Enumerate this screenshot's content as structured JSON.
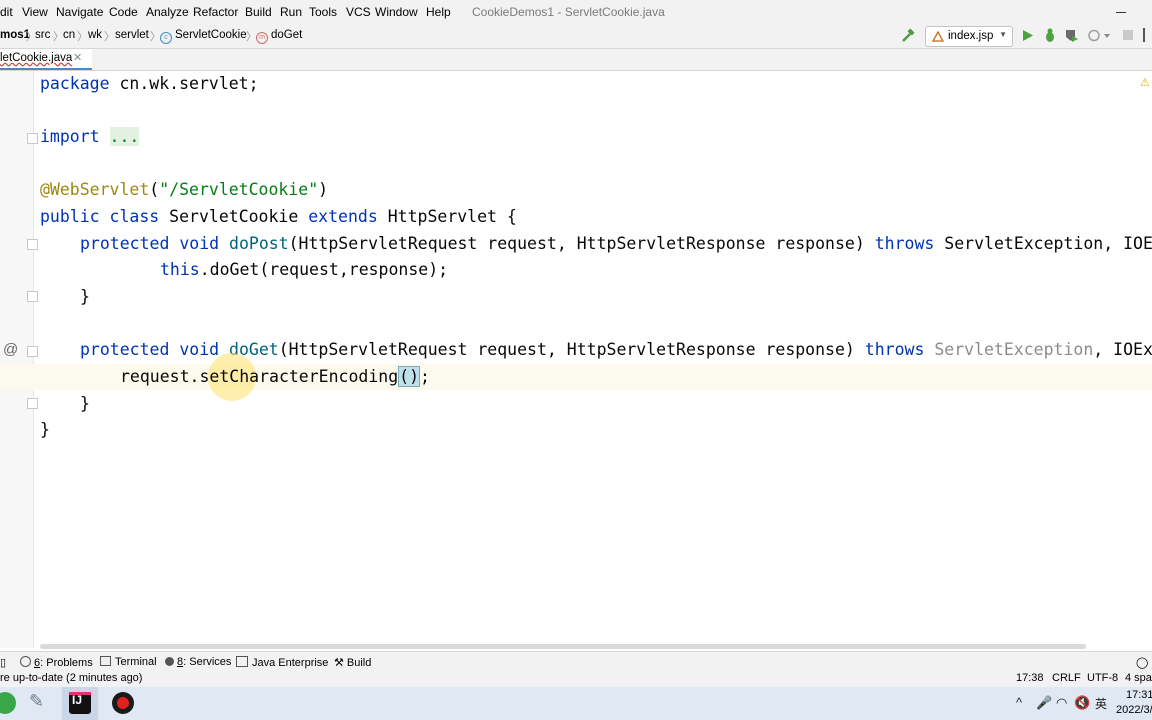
{
  "menubar": {
    "items": [
      "dit",
      "View",
      "Navigate",
      "Code",
      "Analyze",
      "Refactor",
      "Build",
      "Run",
      "Tools",
      "VCS",
      "Window",
      "Help"
    ],
    "window_title": "CookieDemos1 - ServletCookie.java"
  },
  "navbar": {
    "crumbs": [
      "mos1",
      "src",
      "cn",
      "wk",
      "servlet",
      "ServletCookie",
      "doGet"
    ],
    "run_config": "index.jsp"
  },
  "tabs": {
    "active": "letCookie.java"
  },
  "editor": {
    "lines": {
      "l1_kw": "package",
      "l1_rest": " cn.wk.servlet;",
      "l3_kw": "import",
      "l3_dots": "...",
      "l5_ann": "@WebServlet",
      "l5_open": "(",
      "l5_str": "\"/ServletCookie\"",
      "l5_close": ")",
      "l6_kw": "public class",
      "l6_name": " ServletCookie ",
      "l6_kw2": "extends",
      "l6_rest": " HttpServlet {",
      "l7_kw": "protected void",
      "l7_fn": "doPost",
      "l7_params": "(HttpServletRequest request, HttpServletResponse response) ",
      "l7_throws": "throws",
      "l7_rest": " ServletException, IOE",
      "l8_kw": "this",
      "l8_rest": ".doGet(request,response);",
      "l9": "}",
      "l11_kw": "protected void",
      "l11_fn": "doGet",
      "l11_params": "(HttpServletRequest request, HttpServletResponse response) ",
      "l11_throws": "throws",
      "l11_gray": " ServletException",
      "l11_rest": ", IOEx",
      "l12_pre": "request.setCharacterEncoding",
      "l12_paren": "()",
      "l12_end": ";",
      "l13": "}",
      "l14": "}"
    },
    "gutter_marker": "@"
  },
  "tool_windows": {
    "problems_num": "6",
    "problems": ": Problems",
    "terminal": "Terminal",
    "services_num": "8",
    "services": ": Services",
    "java_enterprise": "Java Enterprise",
    "build": "Build"
  },
  "statusbar": {
    "message": "re up-to-date (2 minutes ago)",
    "position": "17:38",
    "line_sep": "CRLF",
    "encoding": "UTF-8",
    "indent": "4 spac"
  },
  "taskbar": {
    "time": "17:31",
    "date": "2022/3/",
    "ime": "英"
  },
  "colors": {
    "keyword": "#0033b3",
    "annotation": "#9e880d",
    "string": "#067d17",
    "method": "#00627a"
  }
}
